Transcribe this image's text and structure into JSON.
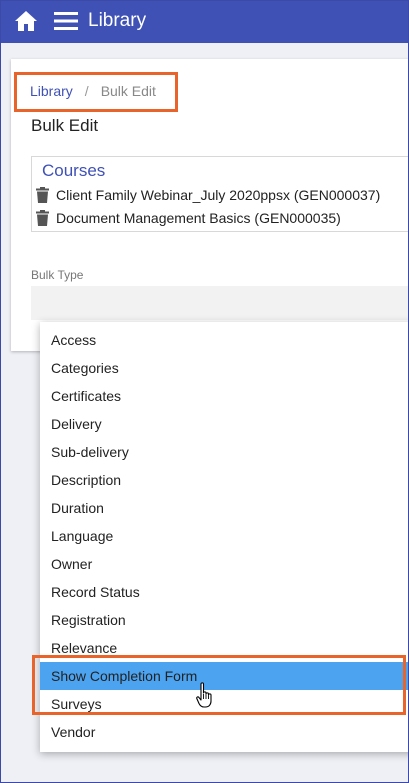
{
  "header": {
    "title": "Library",
    "home_icon": "home-icon",
    "menu_icon": "hamburger-menu-icon",
    "bar_color": "#3f51b5"
  },
  "breadcrumb": {
    "items": [
      "Library",
      "Bulk Edit"
    ],
    "separator": "/"
  },
  "page": {
    "title": "Bulk Edit"
  },
  "courses": {
    "heading": "Courses",
    "items": [
      "Client Family Webinar_July 2020ppsx (GEN000037)",
      "Document Management Basics (GEN000035)"
    ]
  },
  "bulk_type": {
    "label": "Bulk Type",
    "value": "",
    "options": [
      "Access",
      "Categories",
      "Certificates",
      "Delivery",
      "Sub-delivery",
      "Description",
      "Duration",
      "Language",
      "Owner",
      "Record Status",
      "Registration",
      "Relevance",
      "Show Completion Form",
      "Surveys",
      "Vendor"
    ],
    "hovered_option": "Show Completion Form"
  },
  "annotation_color": "#e8642a"
}
